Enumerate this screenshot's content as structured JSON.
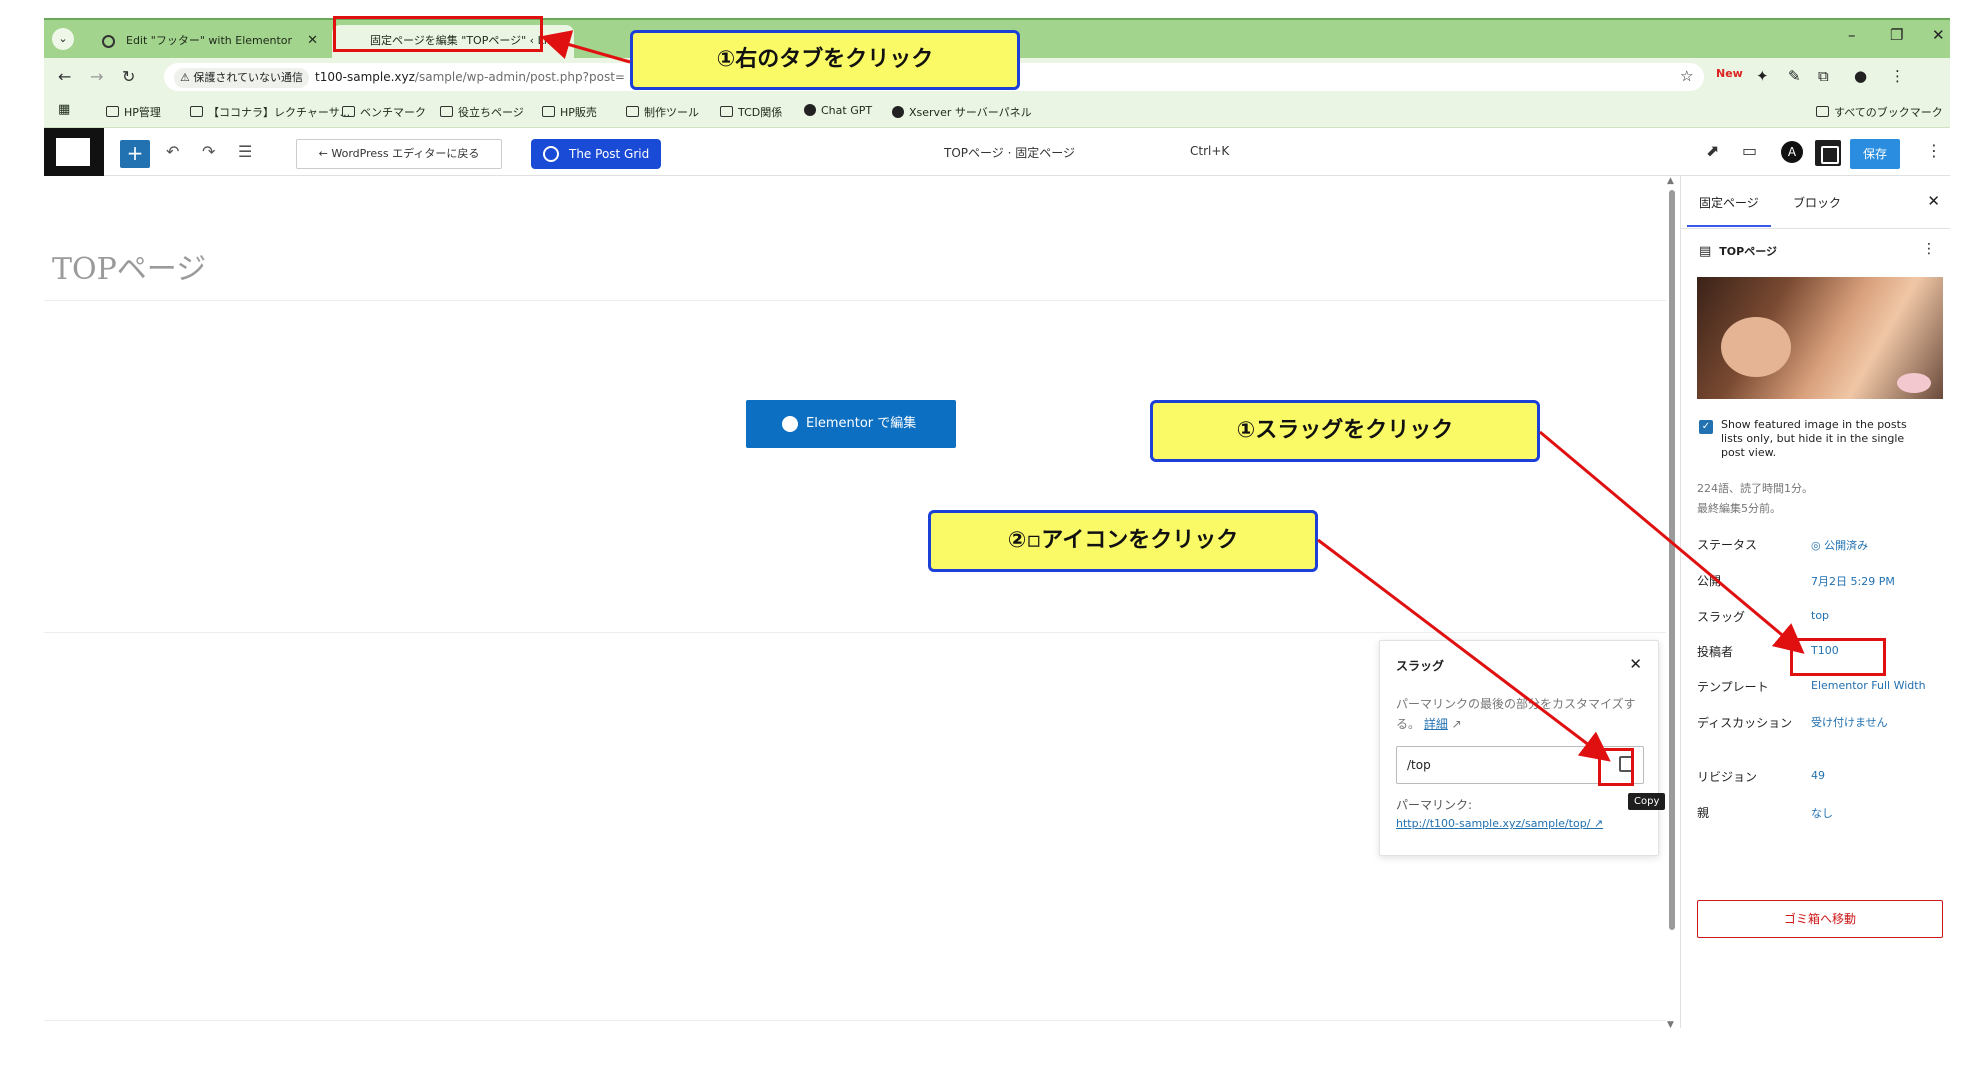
{
  "browser": {
    "tabs": [
      {
        "label": "Edit \"フッター\" with Elementor"
      },
      {
        "label": "固定ページを編集 \"TOPページ\" ‹ LI"
      }
    ],
    "security_badge": "保護されていない通信",
    "url_host": "t100-sample.xyz",
    "url_path": "/sample/wp-admin/post.php?post=",
    "bookmarks": [
      "HP管理",
      "【ココナラ】レクチャーサ...",
      "ベンチマーク",
      "役立ちページ",
      "HP販売",
      "制作ツール",
      "TCD関係",
      "Chat GPT",
      "Xserver サーバーパネル"
    ],
    "all_bookmarks": "すべてのブックマーク",
    "new_badge": "New"
  },
  "editor": {
    "back_label": "← WordPress エディターに戻る",
    "plugin_label": "The Post Grid",
    "doc_title": "TOPページ · 固定ページ",
    "shortcut": "Ctrl+K",
    "save_label": "保存",
    "page_title": "TOPページ",
    "elementor_btn": "Elementor で編集"
  },
  "slug_popover": {
    "title": "スラッグ",
    "desc_prefix": "パーマリンクの最後の部分をカスタマイズする。",
    "desc_link": "詳細",
    "value": "/top",
    "tooltip": "Copy",
    "permalink_label": "パーマリンク:",
    "permalink_url": "http://t100-sample.xyz/sample/top/"
  },
  "sidebar": {
    "tab_page": "固定ページ",
    "tab_block": "ブロック",
    "doc_name": "TOPページ",
    "featured_checkbox": "Show featured image in the posts lists only, but hide it in the single post view.",
    "stats": "224語、読了時間1分。",
    "last_edit": "最終編集5分前。",
    "rows": [
      {
        "label": "ステータス",
        "value": "◎ 公開済み"
      },
      {
        "label": "公開",
        "value": "7月2日 5:29 PM"
      },
      {
        "label": "スラッグ",
        "value": "top"
      },
      {
        "label": "投稿者",
        "value": "T100"
      },
      {
        "label": "テンプレート",
        "value": "Elementor Full Width"
      },
      {
        "label": "ディスカッション",
        "value": "受け付けません"
      },
      {
        "label": "リビジョン",
        "value": "49"
      },
      {
        "label": "親",
        "value": "なし"
      }
    ],
    "trash": "ゴミ箱へ移動"
  },
  "annotations": {
    "callout_tab": "①右のタブをクリック",
    "callout_slug": "①スラッグをクリック",
    "callout_copy": "②▫アイコンをクリック",
    "accent": "#e01010"
  }
}
